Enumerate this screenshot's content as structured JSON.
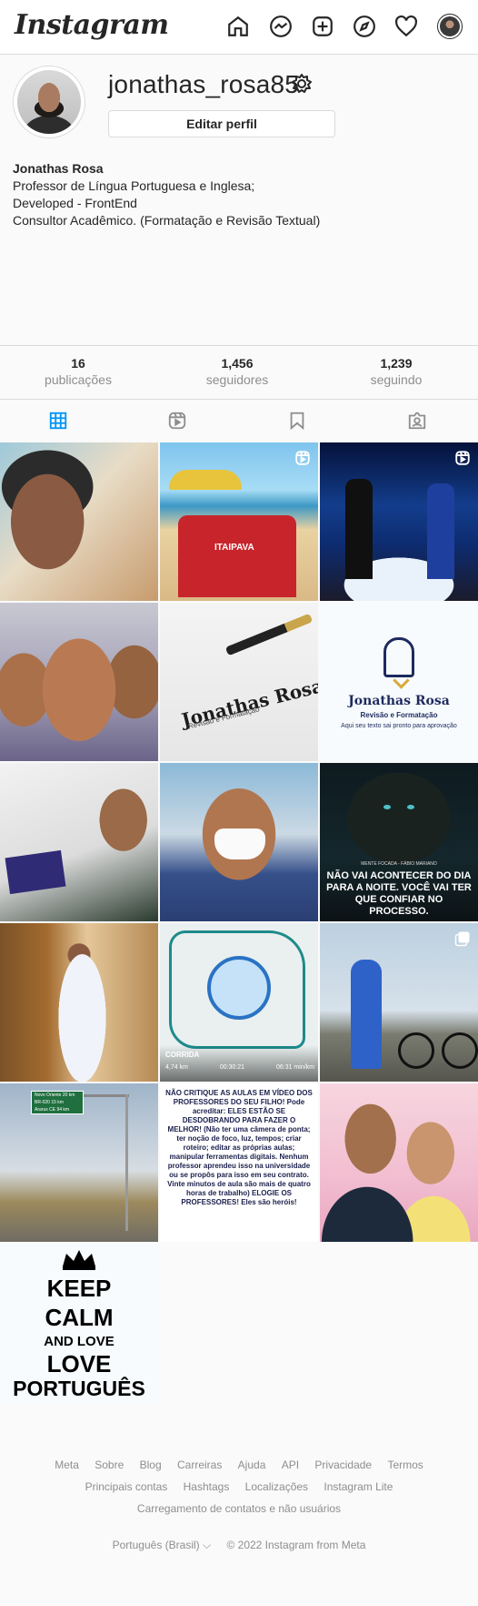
{
  "header": {
    "logo": "Instagram",
    "icons": [
      "home-icon",
      "messenger-icon",
      "new-post-icon",
      "explore-icon",
      "activity-heart-icon",
      "profile-avatar"
    ]
  },
  "profile": {
    "username": "jonathas_rosa85",
    "edit_button": "Editar perfil",
    "full_name": "Jonathas Rosa",
    "bio_lines": [
      "Professor de Língua Portuguesa e Inglesa;",
      "Developed - FrontEnd",
      "Consultor Acadêmico. (Formatação e Revisão Textual)"
    ]
  },
  "stats": [
    {
      "value": "16",
      "label": "publicações"
    },
    {
      "value": "1,456",
      "label": "seguidores"
    },
    {
      "value": "1,239",
      "label": "seguindo"
    }
  ],
  "tabs": [
    "posts-grid-icon",
    "reels-icon",
    "saved-icon",
    "tagged-icon"
  ],
  "posts": {
    "p2_chair_text": "ITAIPAVA",
    "p5_title": "Jonathas Rosa",
    "p5_sub": "Revisão e Formatação",
    "p6_title": "Jonathas Rosa",
    "p6_sub": "Revisão e Formatação",
    "p6_tagline": "Aqui seu texto sai pronto para aprovação",
    "p9_pre": "MENTE FOCADA - FÁBIO MARIANO",
    "p9_text": "NÃO VAI ACONTECER DO DIA PARA A NOITE. VOCÊ VAI TER QUE CONFIAR NO PROCESSO.",
    "p11_label": "CORRIDA",
    "p11_distance": "4,74 km",
    "p11_time": "00:30:21",
    "p11_pace": "06:31 min/km",
    "p13_sign": [
      "Novo Oriente 20 km",
      "BR-020 15 km",
      "Ararus CE 94 km"
    ],
    "p14_text": "NÃO CRITIQUE AS AULAS EM VÍDEO DOS PROFESSORES DO SEU FILHO! Pode acreditar: ELES ESTÃO SE DESDOBRANDO PARA FAZER O MELHOR! (Não ter uma câmera de ponta; ter noção de foco, luz, tempos; criar roteiro; editar as próprias aulas; manipular ferramentas digitais. Nenhum professor aprendeu isso na universidade ou se propôs para isso em seu contrato. Vinte minutos de aula são mais de quatro horas de trabalho) ELOGIE OS PROFESSORES! Eles são heróis!",
    "p16_lines": [
      "KEEP",
      "CALM",
      "AND LOVE",
      "LOVE",
      "PORTUGUÊS"
    ]
  },
  "footer": {
    "links_row1": [
      "Meta",
      "Sobre",
      "Blog",
      "Carreiras",
      "Ajuda",
      "API",
      "Privacidade",
      "Termos"
    ],
    "links_row2": [
      "Principais contas",
      "Hashtags",
      "Localizações",
      "Instagram Lite"
    ],
    "links_row3": "Carregamento de contatos e não usuários",
    "language": "Português (Brasil)",
    "copyright": "© 2022 Instagram from Meta"
  }
}
